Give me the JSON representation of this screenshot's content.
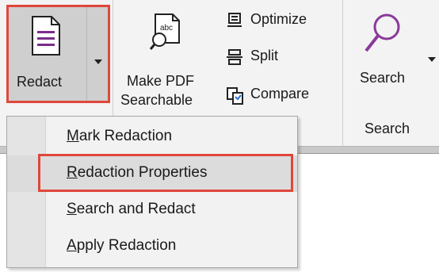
{
  "ribbon": {
    "redact": {
      "label": "Redact",
      "icon": "redact-document-icon"
    },
    "make_pdf_searchable": {
      "line1": "Make PDF",
      "line2": "Searchable",
      "icon": "ocr-search-icon",
      "icon_text": "abc"
    },
    "optimize": {
      "label": "Optimize",
      "icon": "optimize-icon"
    },
    "split": {
      "label": "Split",
      "icon": "split-icon"
    },
    "compare": {
      "label": "Compare",
      "icon": "compare-icon"
    },
    "search": {
      "label": "Search",
      "icon": "magnifier-icon"
    },
    "search_group_label": "Search"
  },
  "menu": {
    "items": [
      {
        "mnemonic": "M",
        "rest": "ark Redaction"
      },
      {
        "mnemonic": "R",
        "rest": "edaction Properties",
        "highlighted": true
      },
      {
        "mnemonic": "S",
        "rest": "earch and Redact"
      },
      {
        "mnemonic": "A",
        "rest": "pply Redaction"
      }
    ]
  },
  "colors": {
    "highlight_outline": "#e0473c",
    "redact_icon_purple": "#7a2e8a",
    "search_icon_purple": "#8a3a9a"
  }
}
